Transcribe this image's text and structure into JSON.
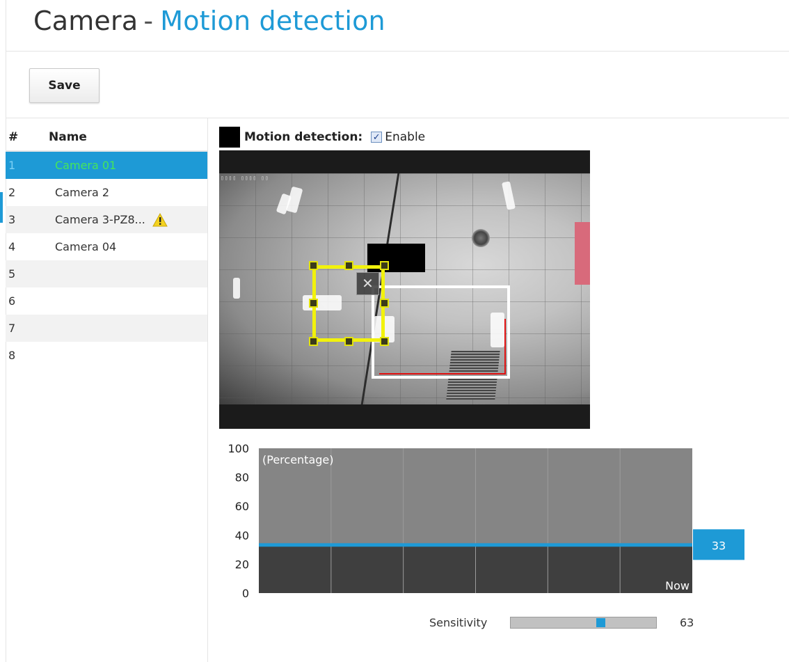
{
  "page": {
    "title_part1": "Camera",
    "title_separator": "-",
    "title_part2": "Motion detection",
    "accent_color": "#1e9ad6"
  },
  "toolbar": {
    "save_label": "Save"
  },
  "camera_list": {
    "col_num": "#",
    "col_name": "Name",
    "rows": [
      {
        "num": "1",
        "name": "Camera 01",
        "selected": true
      },
      {
        "num": "2",
        "name": "Camera 2"
      },
      {
        "num": "3",
        "name": "Camera 3-PZ8...",
        "warning_icon": "warning-icon"
      },
      {
        "num": "4",
        "name": "Camera 04"
      },
      {
        "num": "5",
        "name": ""
      },
      {
        "num": "6",
        "name": ""
      },
      {
        "num": "7",
        "name": ""
      },
      {
        "num": "8",
        "name": ""
      }
    ]
  },
  "motion": {
    "label": "Motion detection:",
    "enable_label": "Enable",
    "enabled": true,
    "swatch_color": "#000000"
  },
  "chart_data": {
    "type": "area",
    "title": "",
    "ylabel": "(Percentage)",
    "ylim": [
      0,
      100
    ],
    "yticks": [
      "100",
      "80",
      "60",
      "40",
      "20",
      "0"
    ],
    "x_label_end": "Now",
    "threshold": 33,
    "threshold_label": "33",
    "grid": true
  },
  "sensitivity": {
    "label": "Sensitivity",
    "value": 63,
    "value_label": "63"
  }
}
